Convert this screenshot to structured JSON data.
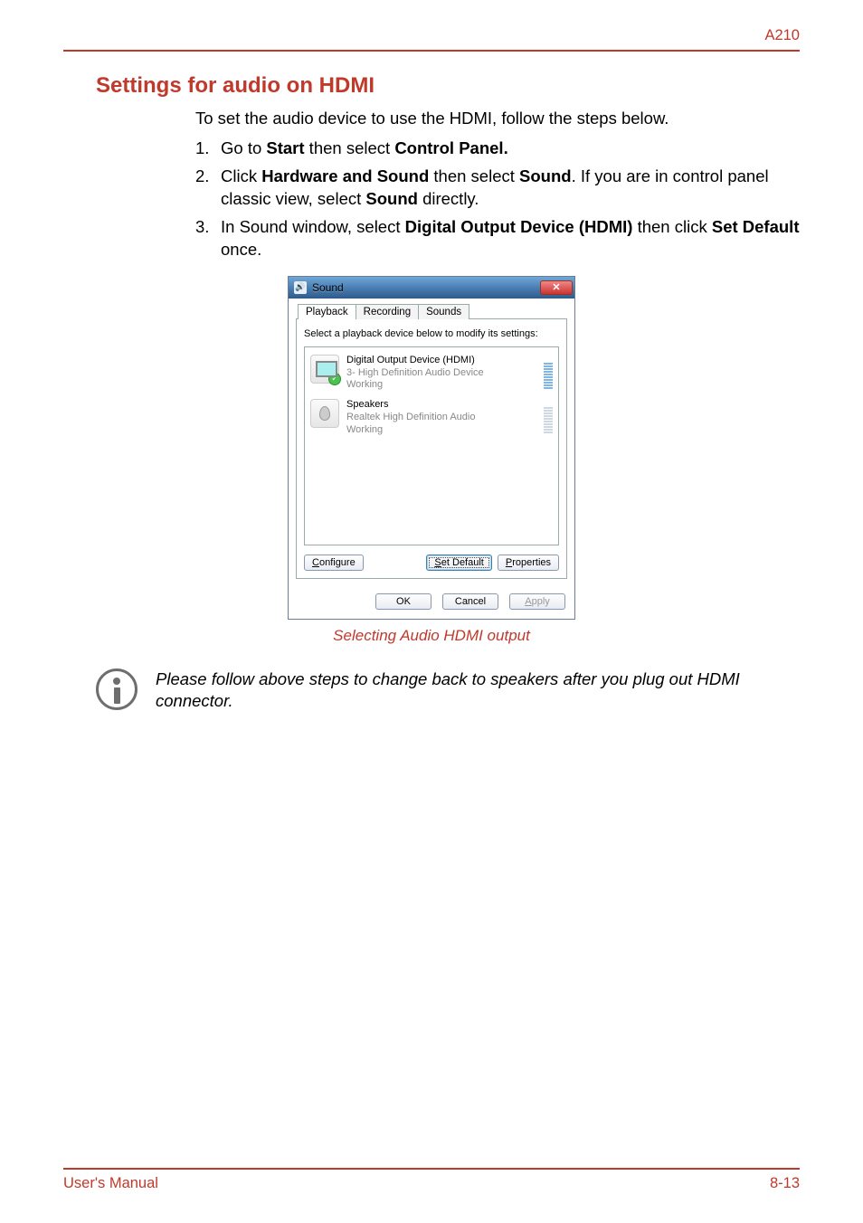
{
  "header": {
    "model": "A210"
  },
  "section": {
    "title": "Settings for audio on HDMI",
    "intro": "To set the audio device to use the HDMI, follow the steps below.",
    "steps": [
      {
        "num": "1.",
        "pre": "Go to ",
        "b1": "Start",
        "mid": " then select ",
        "b2": "Control Panel.",
        "post": ""
      },
      {
        "num": "2.",
        "pre": "Click ",
        "b1": "Hardware and Sound",
        "mid": " then select ",
        "b2": "Sound",
        "post": ". If you are in control panel classic view, select ",
        "b3": "Sound",
        "post2": " directly."
      },
      {
        "num": "3.",
        "pre": "In Sound window, select ",
        "b1": "Digital Output Device (HDMI)",
        "mid": " then click ",
        "b2": "Set Default",
        "post": " once."
      }
    ]
  },
  "dialog": {
    "title": "Sound",
    "tabs": {
      "playback": "Playback",
      "recording": "Recording",
      "sounds": "Sounds"
    },
    "instruction": "Select a playback device below to modify its settings:",
    "devices": [
      {
        "name": "Digital Output Device (HDMI)",
        "driver": "3- High Definition Audio Device",
        "status": "Working"
      },
      {
        "name": "Speakers",
        "driver": "Realtek High Definition Audio",
        "status": "Working"
      }
    ],
    "buttons": {
      "configure": "Configure",
      "setdefault": "Set Default",
      "properties": "Properties",
      "ok": "OK",
      "cancel": "Cancel",
      "apply": "Apply"
    }
  },
  "caption": "Selecting Audio HDMI output",
  "note": "Please follow above steps to change back to speakers after you plug out HDMI connector.",
  "footer": {
    "left": "User's Manual",
    "right": "8-13"
  }
}
